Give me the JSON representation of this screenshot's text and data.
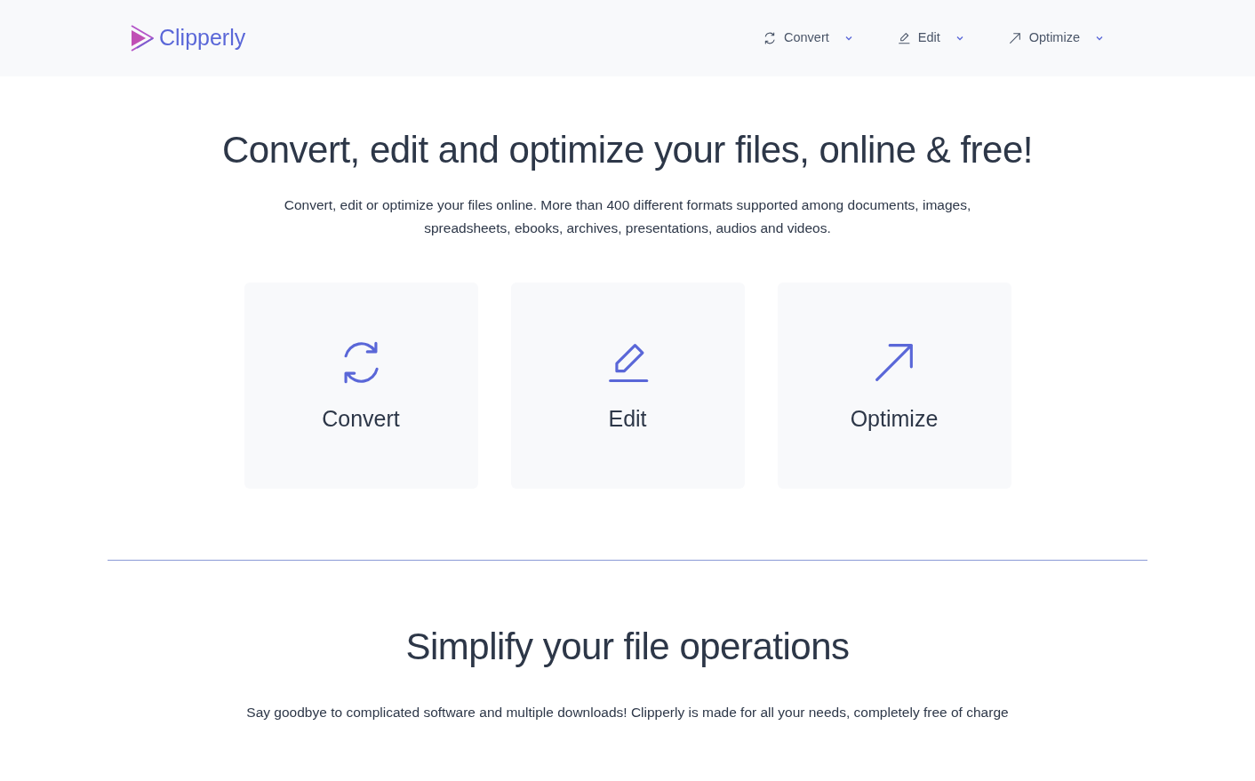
{
  "brand": {
    "name": "Clipperly"
  },
  "nav": [
    {
      "label": "Convert",
      "kind": "convert"
    },
    {
      "label": "Edit",
      "kind": "edit"
    },
    {
      "label": "Optimize",
      "kind": "optimize"
    }
  ],
  "hero": {
    "title": "Convert, edit and optimize your files, online & free!",
    "text": "Convert, edit or optimize your files online. More than 400 different formats supported among documents, images, spreadsheets, ebooks, archives, presentations, audios and videos."
  },
  "tools": [
    {
      "label": "Convert",
      "kind": "convert"
    },
    {
      "label": "Edit",
      "kind": "edit"
    },
    {
      "label": "Optimize",
      "kind": "optimize"
    }
  ],
  "section": {
    "title": "Simplify your file operations",
    "text": "Say goodbye to complicated software and multiple downloads! Clipperly is made for all your needs, completely free of charge"
  }
}
